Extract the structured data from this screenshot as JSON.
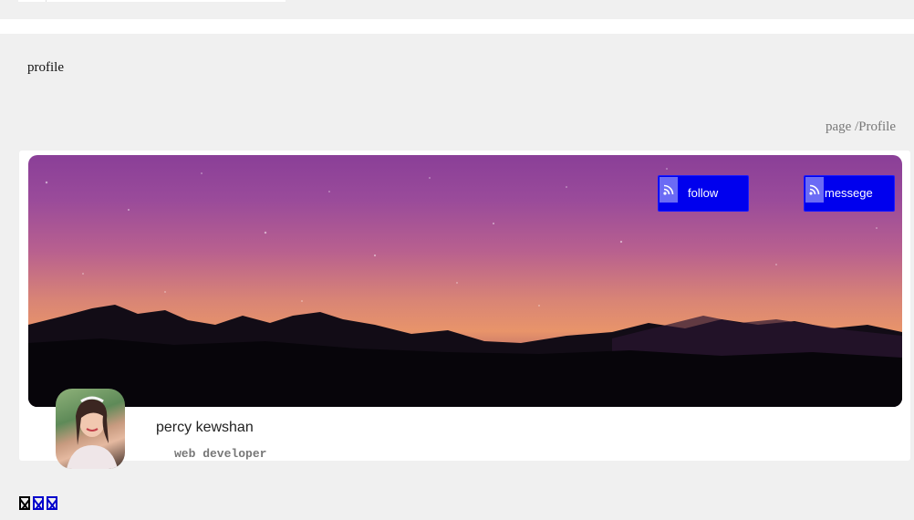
{
  "header": {
    "page_title": "profile",
    "breadcrumb": "page /Profile"
  },
  "profile": {
    "name": "percy kewshan",
    "role": "web developer",
    "follow_label": "follow",
    "message_label": "messege",
    "button_icon": "rss-icon",
    "button_color": "#0000ee"
  },
  "footer_icons": [
    "missing-glyph-icon",
    "missing-glyph-icon",
    "missing-glyph-icon"
  ]
}
